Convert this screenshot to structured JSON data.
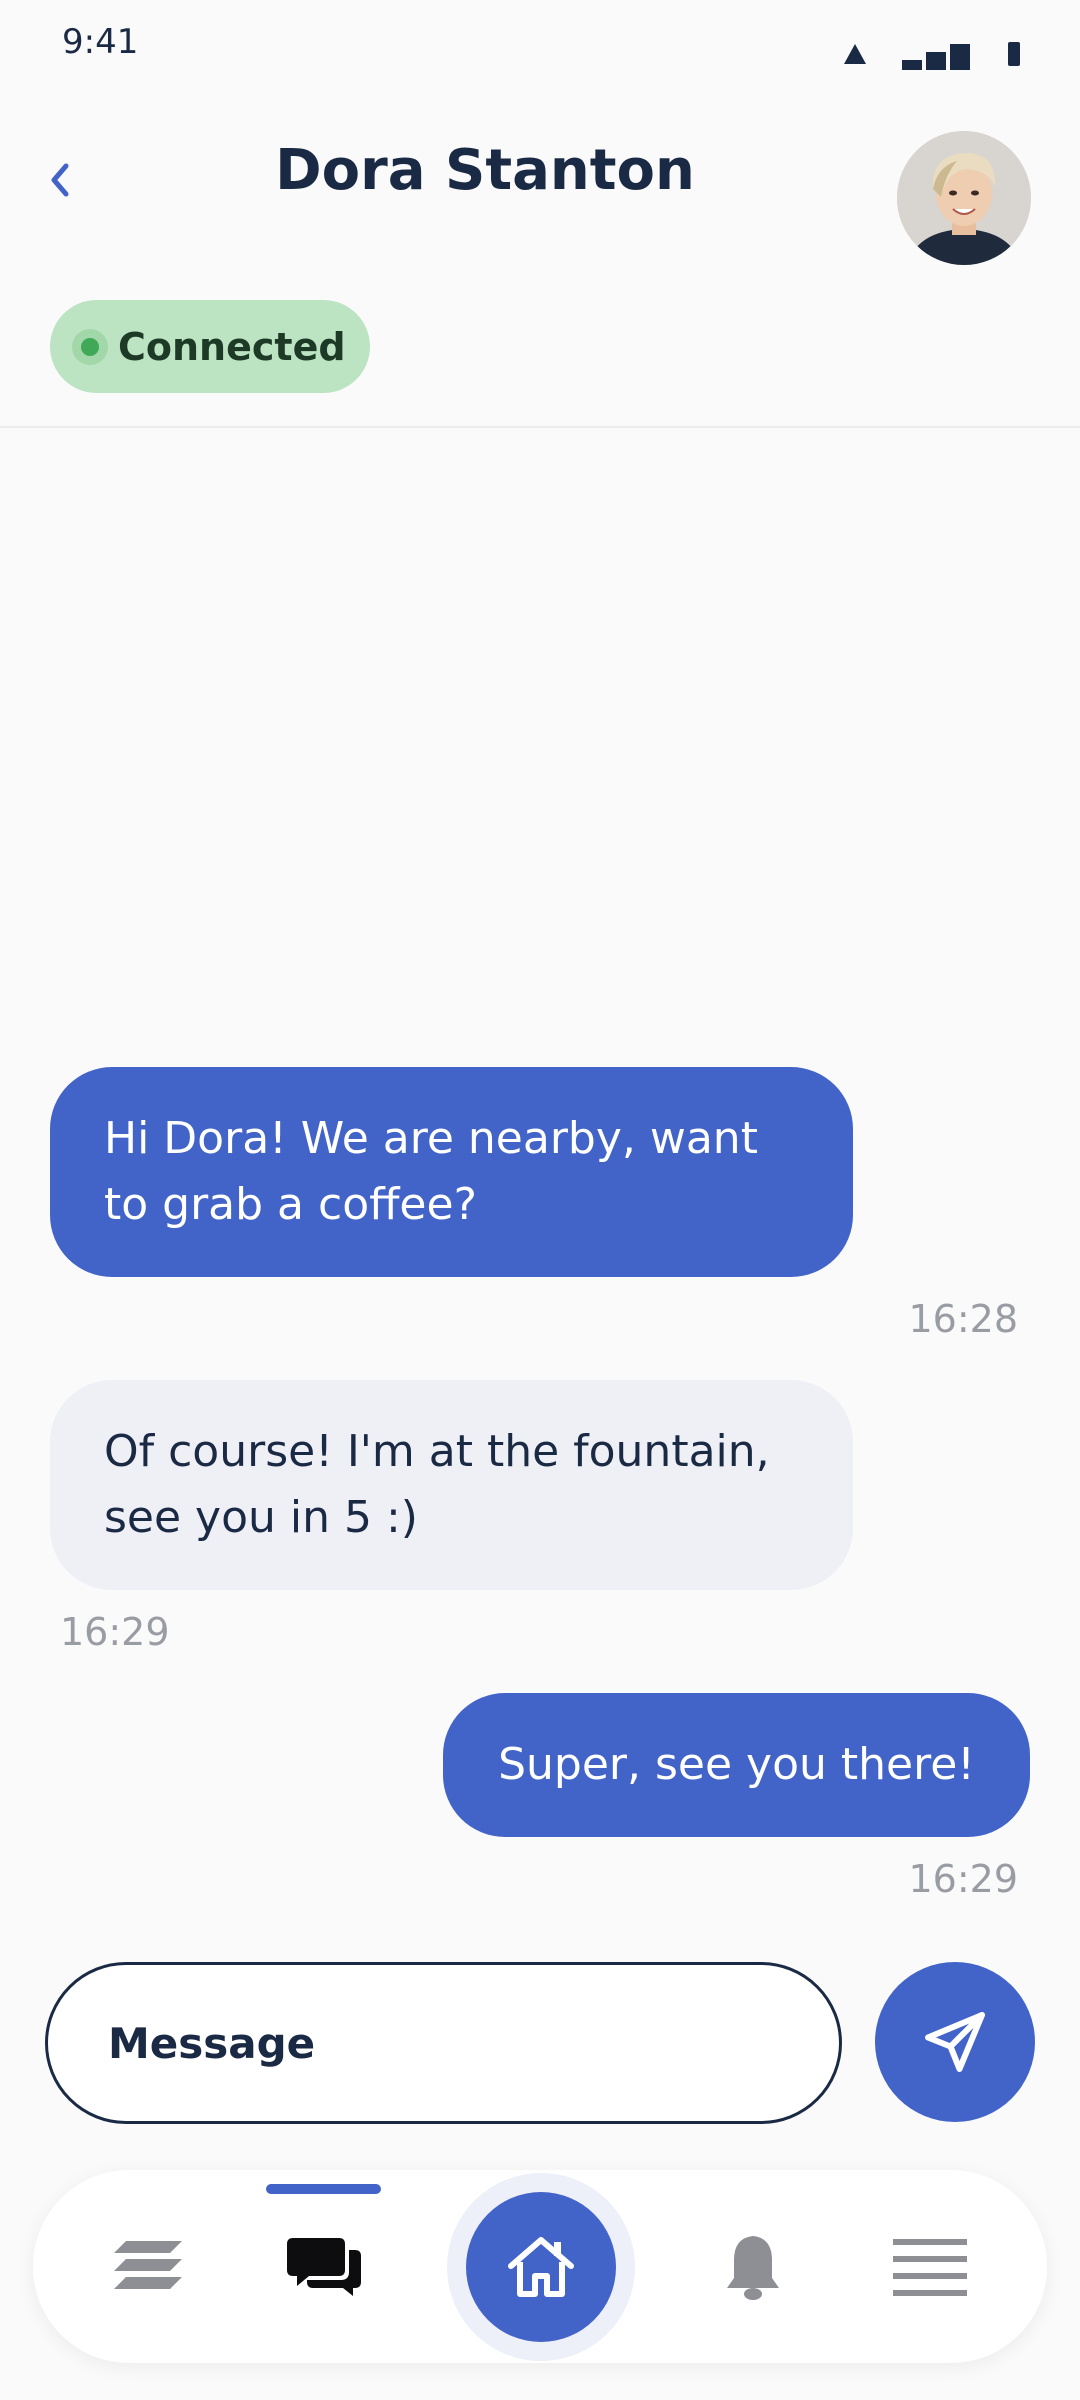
{
  "status_bar": {
    "time": "9:41"
  },
  "header": {
    "title": "Dora Stanton",
    "connection_status": "Connected",
    "icons": {
      "back": "chevron-left-icon",
      "avatar": "avatar"
    }
  },
  "messages": [
    {
      "direction": "outgoing",
      "text": "Hi Dora! We are nearby, want to grab a coffee?",
      "time": "16:28"
    },
    {
      "direction": "incoming",
      "text": "Of course! I'm at the fountain, see you in 5 :)",
      "time": "16:29"
    },
    {
      "direction": "outgoing",
      "text": "Super, see you there!",
      "time": "16:29"
    }
  ],
  "composer": {
    "placeholder": "Message",
    "value": "",
    "send_icon": "send-icon"
  },
  "bottom_nav": {
    "active": "chat",
    "items": [
      {
        "id": "layers",
        "icon": "layers-icon"
      },
      {
        "id": "chat",
        "icon": "chat-icon"
      },
      {
        "id": "home",
        "icon": "home-icon"
      },
      {
        "id": "notifications",
        "icon": "bell-icon"
      },
      {
        "id": "menu",
        "icon": "menu-icon"
      }
    ]
  },
  "colors": {
    "accent": "#4263c8",
    "text_dark": "#1b2a44",
    "status_chip_bg": "#bde4c2",
    "status_dot": "#3fa957",
    "incoming_bubble": "#eff0f5",
    "timestamp": "#9a9ca3",
    "background": "#fafafb"
  }
}
